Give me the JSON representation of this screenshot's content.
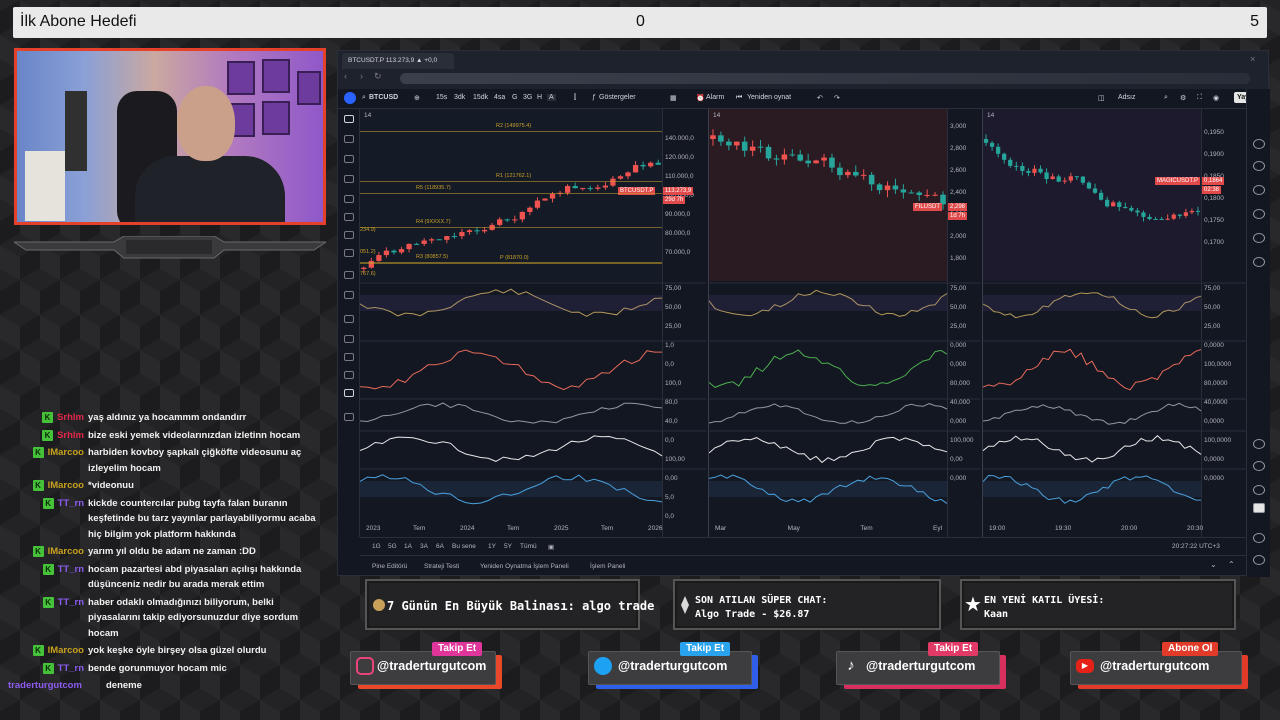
{
  "goal": {
    "title": "İlk Abone Hedefi",
    "current": "0",
    "target": "5"
  },
  "chat": [
    {
      "user": "Srhlm",
      "color": "#e2264a",
      "badge": true,
      "message": "yaş aldınız ya hocammm ondandırr"
    },
    {
      "user": "Srhlm",
      "color": "#e2264a",
      "badge": true,
      "message": "bize eski yemek videolarınızdan izletinn hocam"
    },
    {
      "user": "lMarcoo",
      "color": "#c7a11e",
      "badge": true,
      "message": "harbiden kovboy şapkalı çiğköfte videosunu aç izleyelim hocam"
    },
    {
      "user": "lMarcoo",
      "color": "#c7a11e",
      "badge": true,
      "message": "*videonuu"
    },
    {
      "user": "TT_rn",
      "color": "#8c5cf0",
      "badge": true,
      "message": "kickde countercılar pubg tayfa falan buranın keşfetinde bu tarz yayınlar parlayabiliyormu acaba hiç bilgim yok platform hakkında"
    },
    {
      "user": "lMarcoo",
      "color": "#c7a11e",
      "badge": true,
      "message": "yarım yıl oldu be adam ne zaman :DD"
    },
    {
      "user": "TT_rn",
      "color": "#8c5cf0",
      "badge": true,
      "message": "hocam pazartesi abd piyasaları açılışı hakkında düşünceniz nedir bu arada merak ettim"
    },
    {
      "user": "TT_rn",
      "color": "#8c5cf0",
      "badge": true,
      "message": "haber odaklı olmadığınızı biliyorum, belki piyasalarını takip ediyorsunuzdur diye sordum hocam"
    },
    {
      "user": "lMarcoo",
      "color": "#c7a11e",
      "badge": true,
      "message": "yok keşke öyle birşey olsa güzel olurdu"
    },
    {
      "user": "TT_rn",
      "color": "#8c5cf0",
      "badge": true,
      "message": "bende gorunmuyor hocam mic"
    },
    {
      "user": "traderturgutcom",
      "color": "#8c5cf0",
      "badge": false,
      "message": "deneme"
    }
  ],
  "browser": {
    "tab_title": "BTCUSDT.P 113.273,9 ▲ +0,0"
  },
  "toolbar": {
    "symbol": "BTCUSD",
    "intervals": [
      "15s",
      "3dk",
      "15dk",
      "4sa",
      "G",
      "3G",
      "H",
      "A"
    ],
    "indicators": "Göstergeler",
    "alarm": "Alarm",
    "replay": "Yeniden oynat",
    "layout_name": "Adsız",
    "publish": "Yayınla"
  },
  "charts": [
    {
      "id": "btc",
      "pane_label": "14",
      "price_tag": "BTCUSDT.P",
      "price_value": "113.273,9",
      "price_sub": "29d 7h",
      "price_axis": [
        "140.000,0",
        "120.000,0",
        "110.000,0",
        "100.000,0",
        "90.000,0",
        "80.000,0",
        "70.000,0"
      ],
      "time_axis": [
        "2023",
        "Tem",
        "2024",
        "Tem",
        "2025",
        "Tem",
        "2026"
      ],
      "fib_labels": [
        "R2 (149975.4)",
        "R1 (121762.1)",
        "R5 (118935.7)",
        "P (81870.0)",
        "R4 (9XXXX.7)",
        "R3 (80857.5)"
      ],
      "left_labels": [
        "234.9)",
        "051.2)",
        "767.6)"
      ],
      "osc_axis": [
        "75,00",
        "50,00",
        "25,00",
        "1,0",
        "0,0",
        "100,0",
        "80,0",
        "40,0",
        "0,0",
        "100,00",
        "0,00",
        "5,0",
        "0,0"
      ]
    },
    {
      "id": "fil",
      "pane_label": "14",
      "price_tag": "FILUSDT",
      "price_value": "2,298",
      "price_sub": "1d 7h",
      "price_axis": [
        "3,000",
        "2,800",
        "2,600",
        "2,400",
        "2,200",
        "2,000",
        "1,800"
      ],
      "time_axis": [
        "Mar",
        "May",
        "Tem",
        "Eyl"
      ],
      "osc_axis": [
        "75,00",
        "50,00",
        "25,00",
        "0,000",
        "0,000",
        "80,000",
        "40,000",
        "0,000",
        "100,000",
        "0,00",
        "0,000"
      ]
    },
    {
      "id": "magic",
      "pane_label": "14",
      "price_tag": "MAGICUSDT.P",
      "price_value": "0,1864",
      "price_sub": "02:38",
      "price_axis": [
        "0,1950",
        "0,1900",
        "0,1850",
        "0,1800",
        "0,1750",
        "0,1700"
      ],
      "time_axis": [
        "19:00",
        "19:30",
        "20:00",
        "20:30"
      ],
      "osc_axis": [
        "75,00",
        "50,00",
        "25,00",
        "0,0000",
        "100,0000",
        "80,0000",
        "40,0000",
        "0,0000",
        "100,0000",
        "0,0000",
        "0,0000"
      ]
    }
  ],
  "bottom_ranges": [
    "1G",
    "5G",
    "1A",
    "3A",
    "6A",
    "Bu sene",
    "1Y",
    "5Y",
    "Tümü"
  ],
  "clock": "20:27:22 UTC+3",
  "panels": [
    "Pine Editörü",
    "Strateji Testi",
    "Yeniden Oynatma İşlem Paneli",
    "İşlem Paneli"
  ],
  "info": {
    "whale": "7 Günün En Büyük Balinası: algo trade",
    "superchat_title": "SON ATILAN SÜPER CHAT:",
    "superchat_value": "Algo Trade - $26.87",
    "member_title": "EN YENİ KATIL ÜYESİ:",
    "member_value": "Kaan"
  },
  "social": [
    {
      "platform": "instagram",
      "tag": "Takip Et",
      "handle": "@traderturgutcom",
      "tag_color": "#e0359a",
      "back_color": "#e8472a",
      "icon": "instagram-icon"
    },
    {
      "platform": "twitter",
      "tag": "Takip Et",
      "handle": "@traderturgutcom",
      "tag_color": "#2aa3ef",
      "back_color": "#2f5ee8",
      "icon": "twitter-icon"
    },
    {
      "platform": "tiktok",
      "tag": "Takip Et",
      "handle": "@traderturgutcom",
      "tag_color": "#e13a67",
      "back_color": "#d82f5e",
      "icon": "tiktok-icon"
    },
    {
      "platform": "youtube",
      "tag": "Abone Ol",
      "handle": "@traderturgutcom",
      "tag_color": "#e23b2a",
      "back_color": "#e23b2a",
      "icon": "youtube-icon"
    }
  ],
  "colors": {
    "accent_red": "#e4402a",
    "candle_up": "#26a69a",
    "candle_down": "#ef5350",
    "tv_bg": "#131722"
  }
}
